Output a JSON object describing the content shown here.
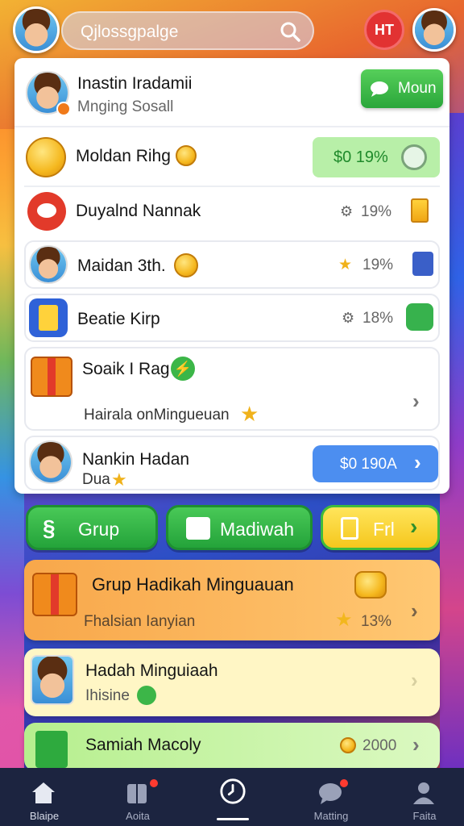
{
  "search": {
    "text": "Qjlossgpalge"
  },
  "header": {
    "badge": "HT"
  },
  "profile": {
    "name": "Inastin Iradamii",
    "subtitle": "Mnging Sosall",
    "button_label": "Moun"
  },
  "rows": [
    {
      "title": "Moldan Rihg",
      "value": "$0 19%"
    },
    {
      "title": "Duyalnd Nannak",
      "value": "19%"
    },
    {
      "title": "Maidan 3th.",
      "value": "19%"
    },
    {
      "title": "Beatie Kirp",
      "value": "18%"
    },
    {
      "title": "Soaik I Rag",
      "subtitle": "Hairala onMingueuan"
    },
    {
      "title": "Nankin Hadan",
      "subtitle": "Dua",
      "value": "$0 190A"
    }
  ],
  "actions": [
    {
      "label": "Grup"
    },
    {
      "label": "Madiwah"
    },
    {
      "label": "Frl"
    }
  ],
  "cards": [
    {
      "title": "Grup Hadikah Minguauan",
      "subtitle": "Fhalsian Ianyian",
      "value": "13%"
    },
    {
      "title": "Hadah Minguiaah",
      "subtitle": "Ihisine"
    },
    {
      "title": "Samiah Macoly",
      "value": "2000"
    }
  ],
  "nav": [
    {
      "label": "Blaipe",
      "icon": "home-icon"
    },
    {
      "label": "Aoita",
      "icon": "book-icon"
    },
    {
      "label": "",
      "icon": "clock-icon"
    },
    {
      "label": "Matting",
      "icon": "chat-icon"
    },
    {
      "label": "Faita",
      "icon": "person-icon"
    }
  ],
  "colors": {
    "accent_green": "#2aa63a",
    "accent_blue": "#4c8ef0",
    "nav_bg": "#1c2440",
    "badge_red": "#e23232"
  }
}
